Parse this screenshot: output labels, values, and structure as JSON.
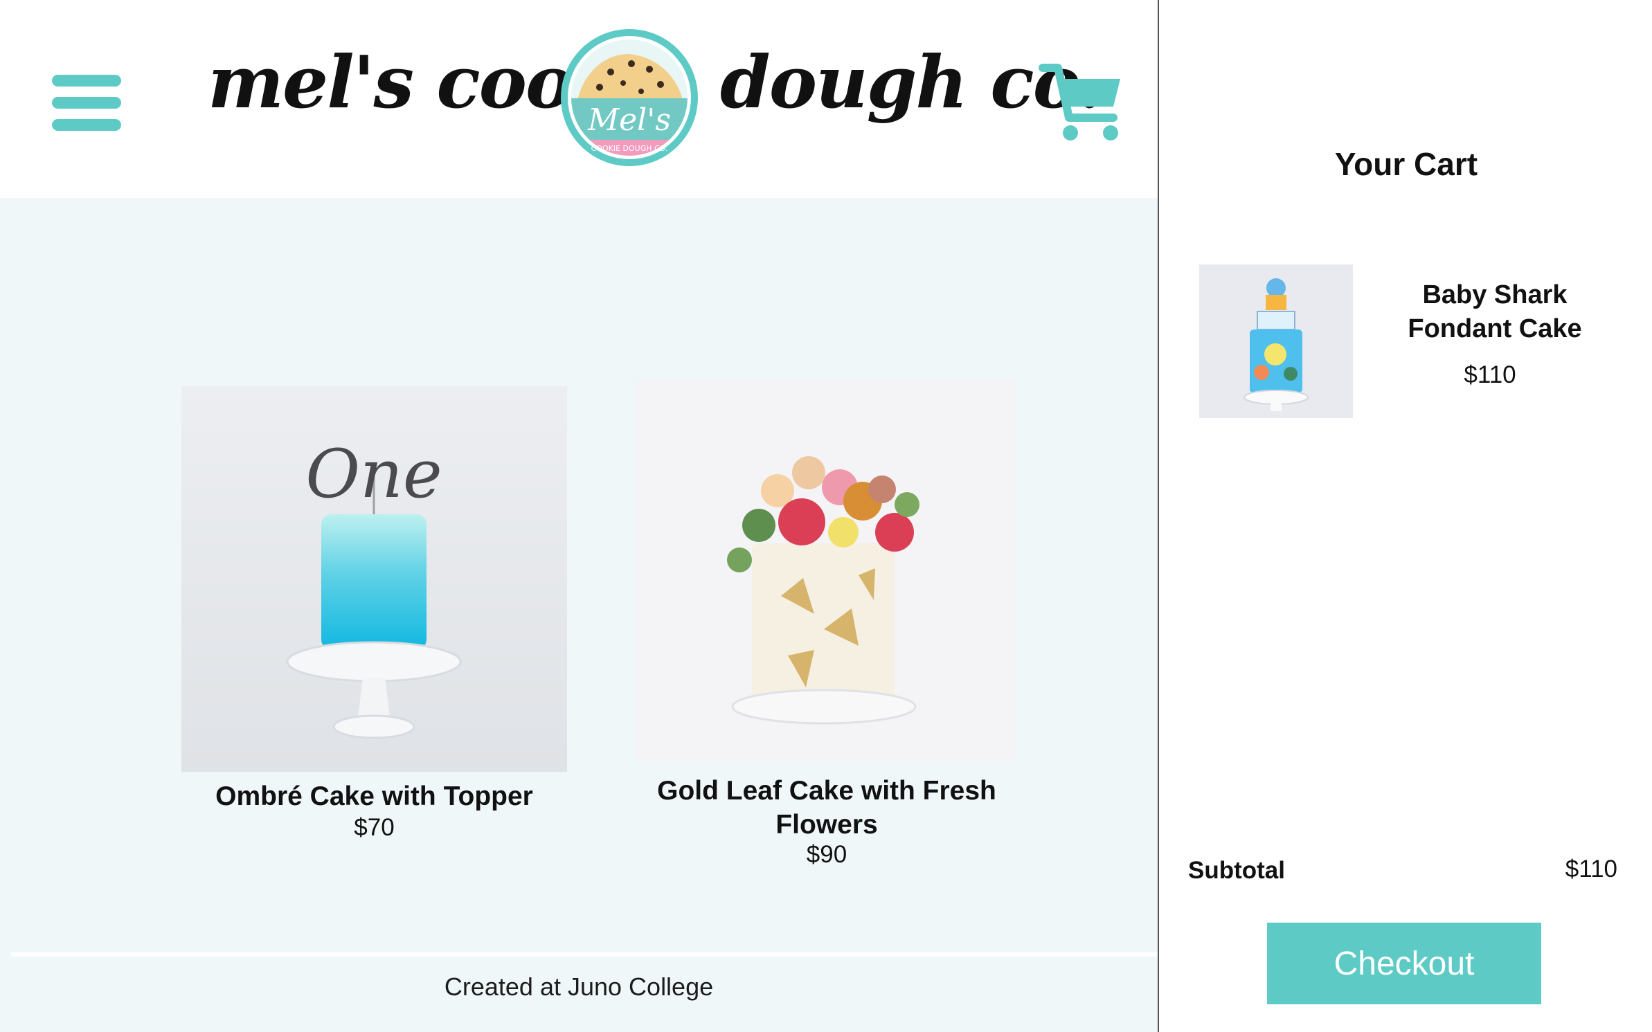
{
  "colors": {
    "accent": "#5ecac5",
    "background": "#f0f7f9",
    "text": "#111111"
  },
  "header": {
    "menu_icon": "hamburger-menu-icon",
    "logo": {
      "left_text": "mel's cookie",
      "right_text": "dough co.",
      "badge_script": "Mel's",
      "badge_subtext": "COOKIE DOUGH CO."
    },
    "cart_icon": "shopping-cart-icon"
  },
  "products": [
    {
      "name": "Ombré Cake with Topper",
      "price": "$70",
      "image_topper": "One"
    },
    {
      "name": "Gold Leaf Cake with Fresh Flowers",
      "price": "$90"
    }
  ],
  "footer": {
    "text": "Created at Juno College"
  },
  "cart": {
    "title": "Your Cart",
    "items": [
      {
        "name": "Baby Shark Fondant Cake",
        "price": "$110"
      }
    ],
    "subtotal_label": "Subtotal",
    "subtotal_value": "$110",
    "checkout_label": "Checkout"
  }
}
